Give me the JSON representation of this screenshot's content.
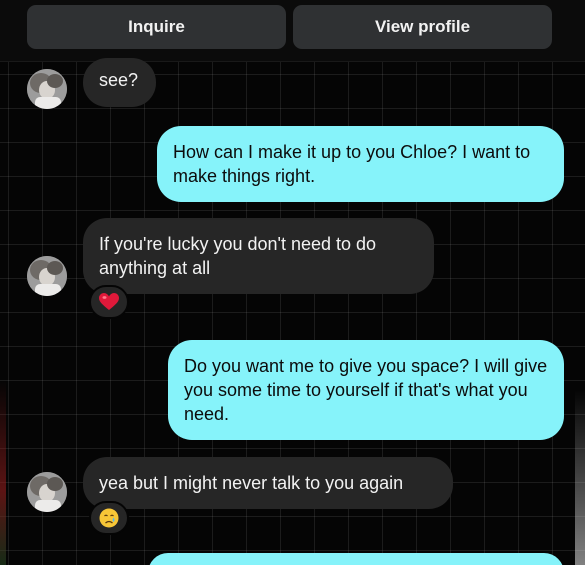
{
  "header": {
    "inquire_label": "Inquire",
    "view_profile_label": "View profile"
  },
  "messages": [
    {
      "side": "incoming",
      "text": "see?"
    },
    {
      "side": "outgoing",
      "text": "How can I make it up to you Chloe? I want to make things right."
    },
    {
      "side": "incoming",
      "text": "If you're lucky you don't need to do anything at all",
      "reaction": "heart-emoji"
    },
    {
      "side": "outgoing",
      "text": "Do you want me to give you space? I will give you some time to yourself if that's what you need."
    },
    {
      "side": "incoming",
      "text": "yea but I might never talk to you again",
      "reaction": "crying-face-emoji"
    },
    {
      "side": "outgoing",
      "text": ""
    }
  ],
  "colors": {
    "background": "#050505",
    "incoming_bubble": "#262626",
    "outgoing_bubble": "#86f3fa",
    "header_button": "#2f3133",
    "heart": "#e0193a"
  }
}
